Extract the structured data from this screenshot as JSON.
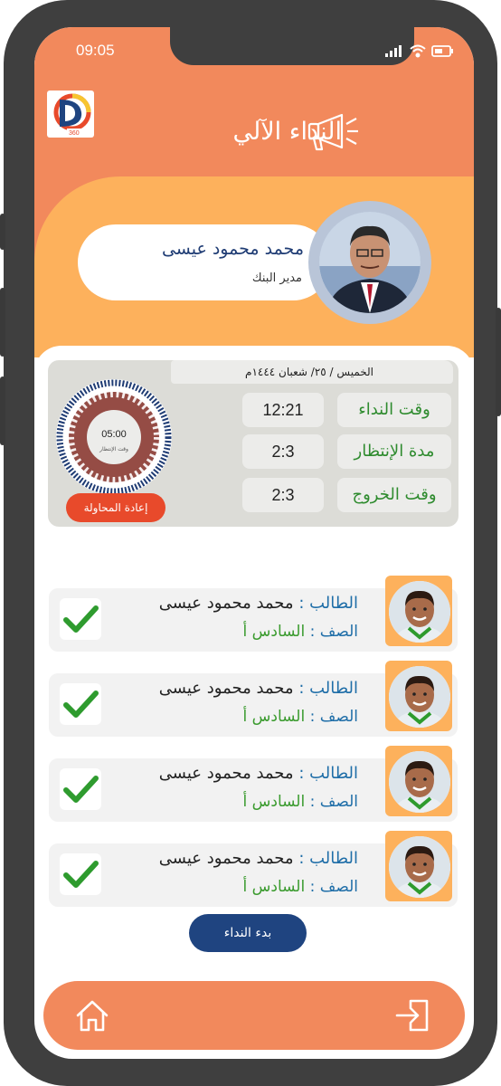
{
  "status_bar": {
    "time": "09:05"
  },
  "header": {
    "title": "النداء الآلي"
  },
  "profile": {
    "name": "محمد محمود عيسى",
    "role": "مدير البنك"
  },
  "call_panel": {
    "date": "الخميس / ٢٥/ شعبان ١٤٤٤م",
    "rows": [
      {
        "label": "وقت النداء",
        "value": "12:21"
      },
      {
        "label": "مدة الإنتظار",
        "value": "2:3"
      },
      {
        "label": "وقت الخروج",
        "value": "2:3"
      }
    ],
    "timer": {
      "time": "05:00",
      "caption": "وقت الإنتظار"
    },
    "retry_label": "إعادة المحاولة"
  },
  "students": [
    {
      "name_label": "الطالب :",
      "name": "محمد محمود عيسى",
      "class_label": "الصف :",
      "class": "السادس أ",
      "status_icon": "check-icon"
    },
    {
      "name_label": "الطالب :",
      "name": "محمد محمود عيسى",
      "class_label": "الصف :",
      "class": "السادس أ",
      "status_icon": "check-icon"
    },
    {
      "name_label": "الطالب :",
      "name": "محمد محمود عيسى",
      "class_label": "الصف :",
      "class": "السادس أ",
      "status_icon": "check-icon"
    },
    {
      "name_label": "الطالب :",
      "name": "محمد محمود عيسى",
      "class_label": "الصف :",
      "class": "السادس أ",
      "status_icon": "check-icon"
    }
  ],
  "start_button": "بدء النداء",
  "bottom_nav": {
    "left_icon": "home-icon",
    "right_icon": "exit-icon"
  },
  "colors": {
    "primary_orange": "#F2895C",
    "secondary_orange": "#FDB15C",
    "navy": "#1f4480",
    "green": "#2e8b2e",
    "red": "#E84A2B"
  }
}
